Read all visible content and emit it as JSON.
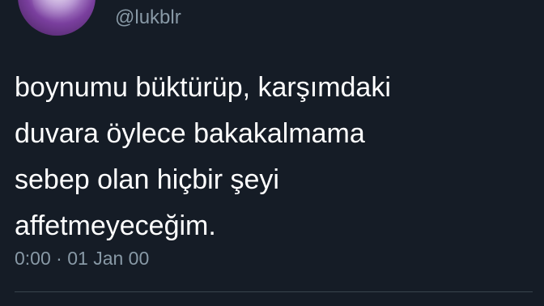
{
  "user": {
    "handle": "@lukblr"
  },
  "tweet": {
    "lines": [
      "boynumu büktürüp, karşımdaki",
      "duvara öylece bakakalmama",
      "sebep olan hiçbir şeyi",
      "affetmeyeceğim."
    ],
    "time": "0:00",
    "separator": "·",
    "date": "01 Jan 00"
  },
  "colors": {
    "background": "#151c26",
    "text": "#ffffff",
    "secondary_text": "#8899a6",
    "divider": "#38444d"
  }
}
